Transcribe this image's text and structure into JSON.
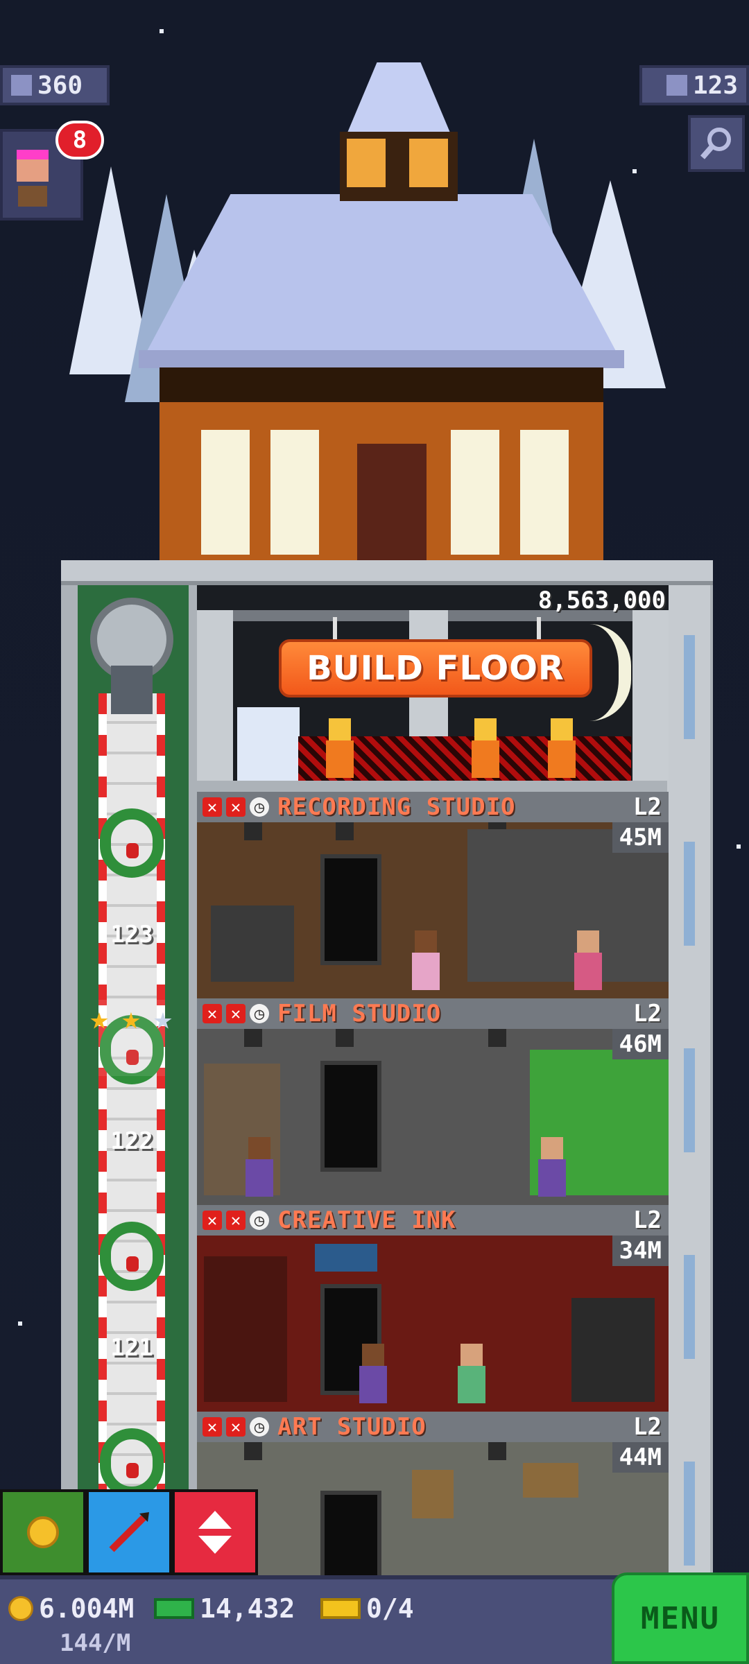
{
  "hud": {
    "population": "360",
    "floor_count": "123",
    "notifications": "8"
  },
  "build": {
    "cost": "8,563,000",
    "button_label": "BUILD FLOOR"
  },
  "floors": [
    {
      "name": "RECORDING STUDIO",
      "level": "L2",
      "value": "45M"
    },
    {
      "name": "FILM STUDIO",
      "level": "L2",
      "value": "46M"
    },
    {
      "name": "CREATIVE INK",
      "level": "L2",
      "value": "34M"
    },
    {
      "name": "ART STUDIO",
      "level": "L2",
      "value": "44M"
    }
  ],
  "elevator": {
    "floor_labels": [
      "123",
      "122",
      "121"
    ]
  },
  "bottom": {
    "coins": "6.004M",
    "income": "144/M",
    "bux": "14,432",
    "tickets": "0/4",
    "menu_label": "MENU"
  },
  "colors": {
    "sky": "#141a2a",
    "hud": "#4a4f78",
    "build_button": "#f2581a",
    "floor_name": "#ff7a52",
    "menu": "#2cc64a"
  }
}
